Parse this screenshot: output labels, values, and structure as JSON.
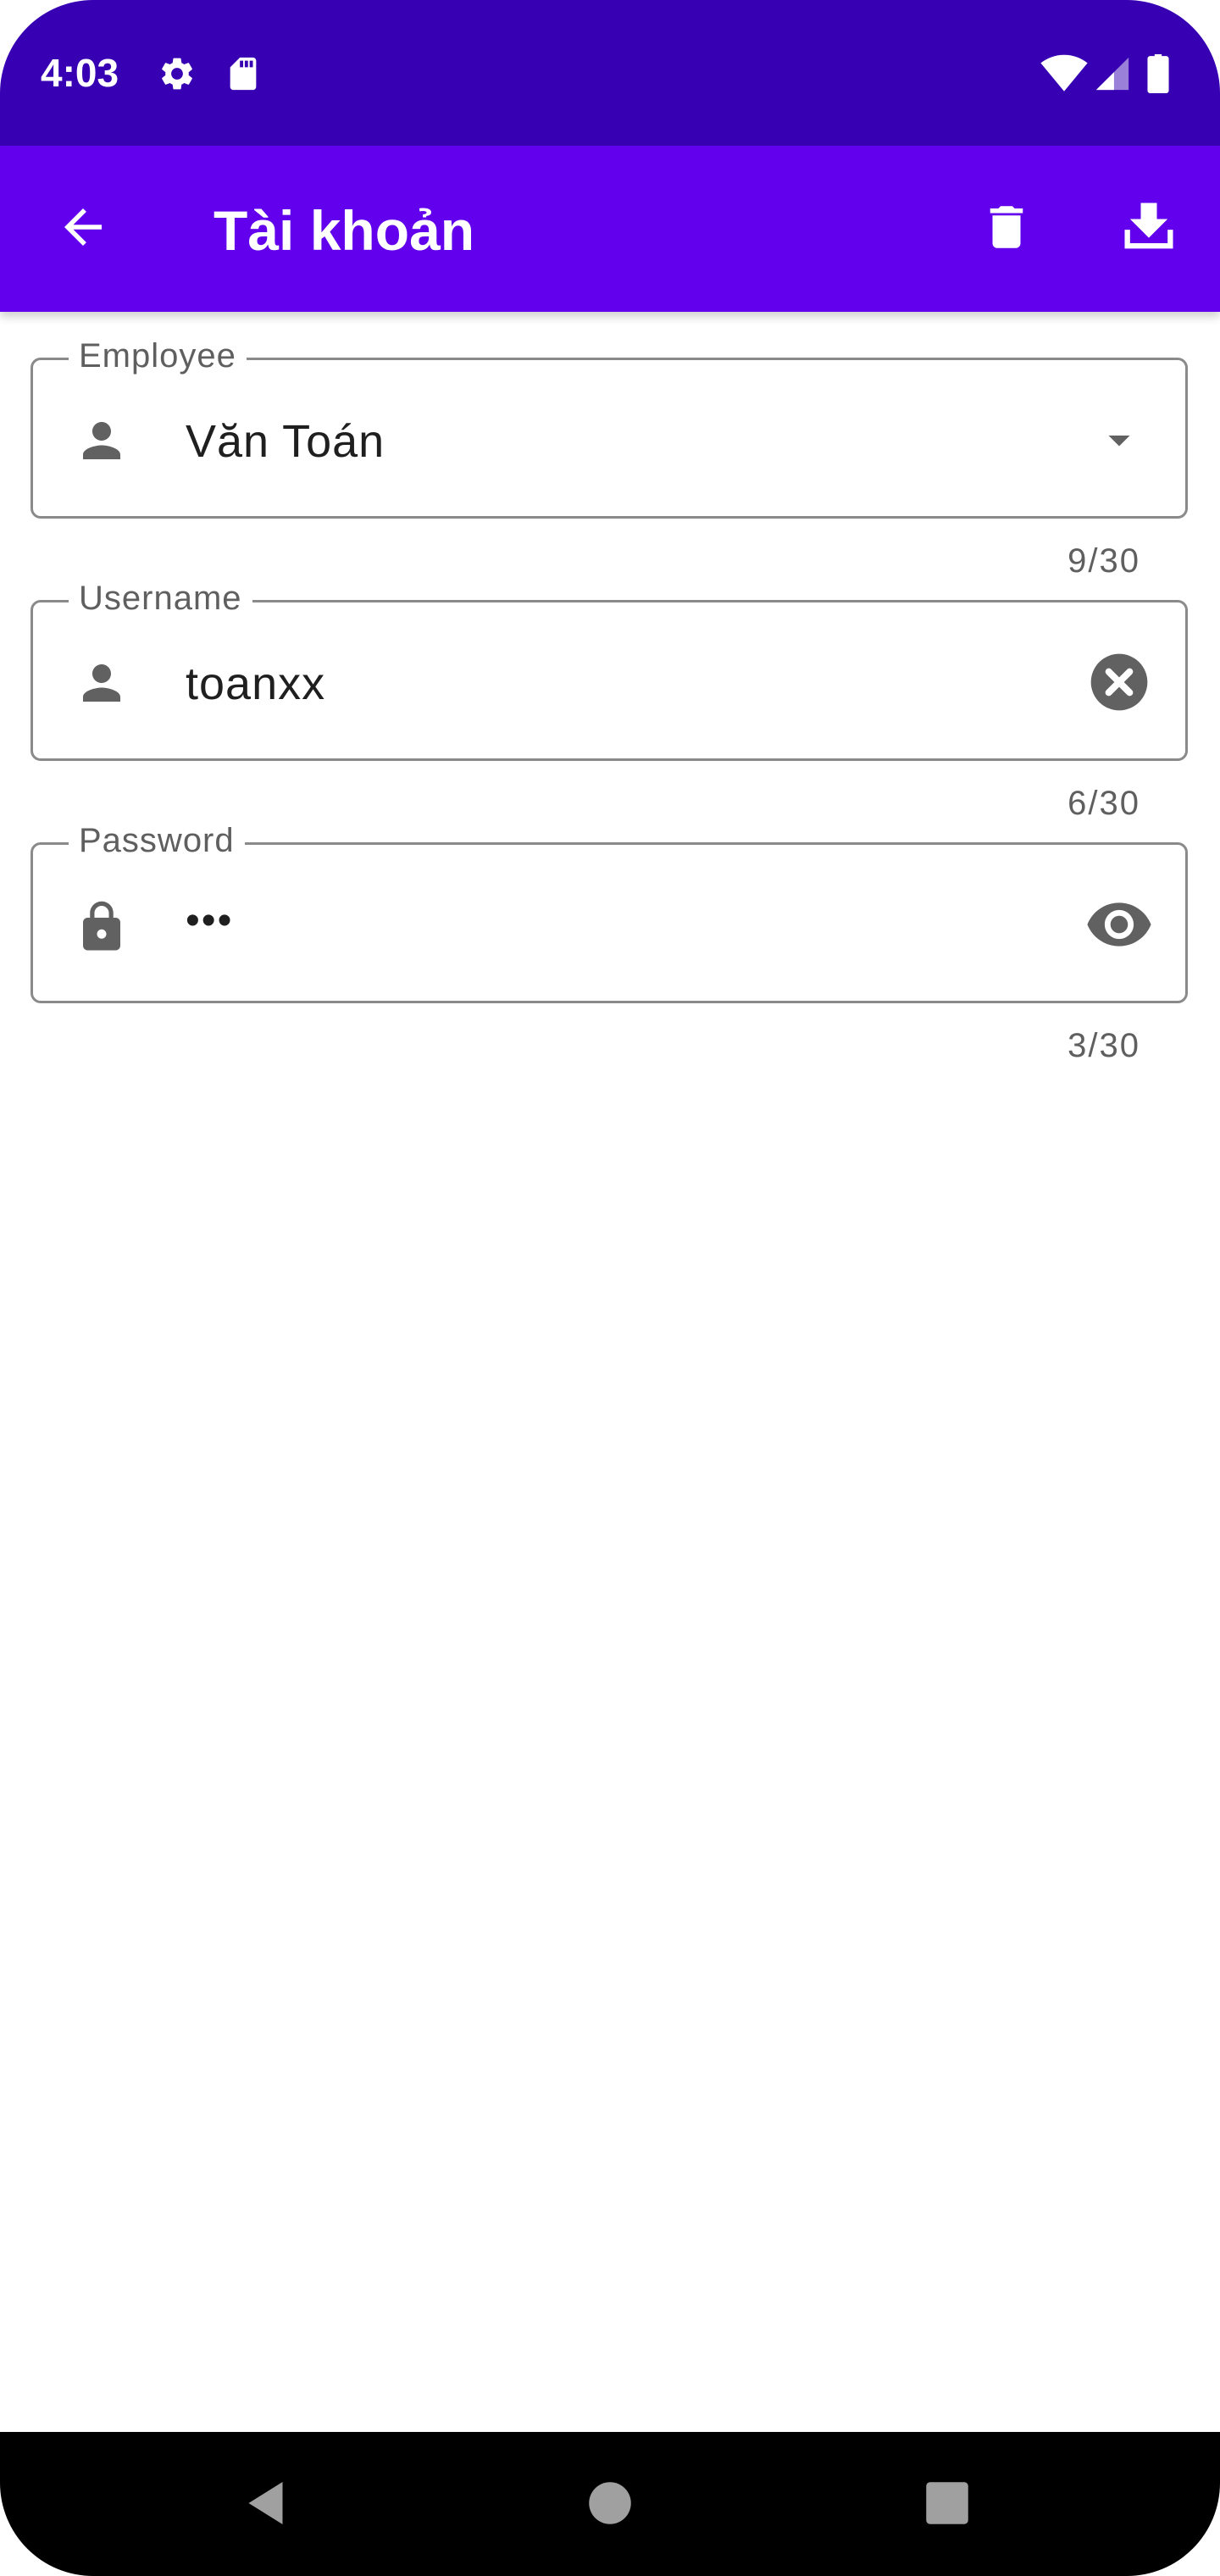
{
  "status_bar": {
    "time": "4:03",
    "icons": [
      "settings-icon",
      "sd-card-icon",
      "wifi-icon",
      "cell-signal-icon",
      "battery-icon"
    ]
  },
  "app_bar": {
    "title": "Tài khoản",
    "back_icon": "arrow-back-icon",
    "actions": [
      "delete-icon",
      "download-icon"
    ],
    "background": "#6200ee"
  },
  "form": {
    "employee": {
      "label": "Employee",
      "value": "Văn Toán",
      "counter": "9/30",
      "lead_icon": "person-icon",
      "trail_icon": "dropdown-arrow-icon"
    },
    "username": {
      "label": "Username",
      "value": "toanxx",
      "counter": "6/30",
      "lead_icon": "person-icon",
      "trail_icon": "clear-icon"
    },
    "password": {
      "label": "Password",
      "value": "•••",
      "counter": "3/30",
      "lead_icon": "lock-icon",
      "trail_icon": "eye-icon"
    }
  },
  "colors": {
    "status_bar": "#3700b3",
    "app_bar": "#6200ee",
    "icon_gray": "#616161",
    "outline": "#8a8a8a"
  },
  "nav_bar": {
    "buttons": [
      "back-triangle-icon",
      "home-circle-icon",
      "recents-square-icon"
    ]
  }
}
